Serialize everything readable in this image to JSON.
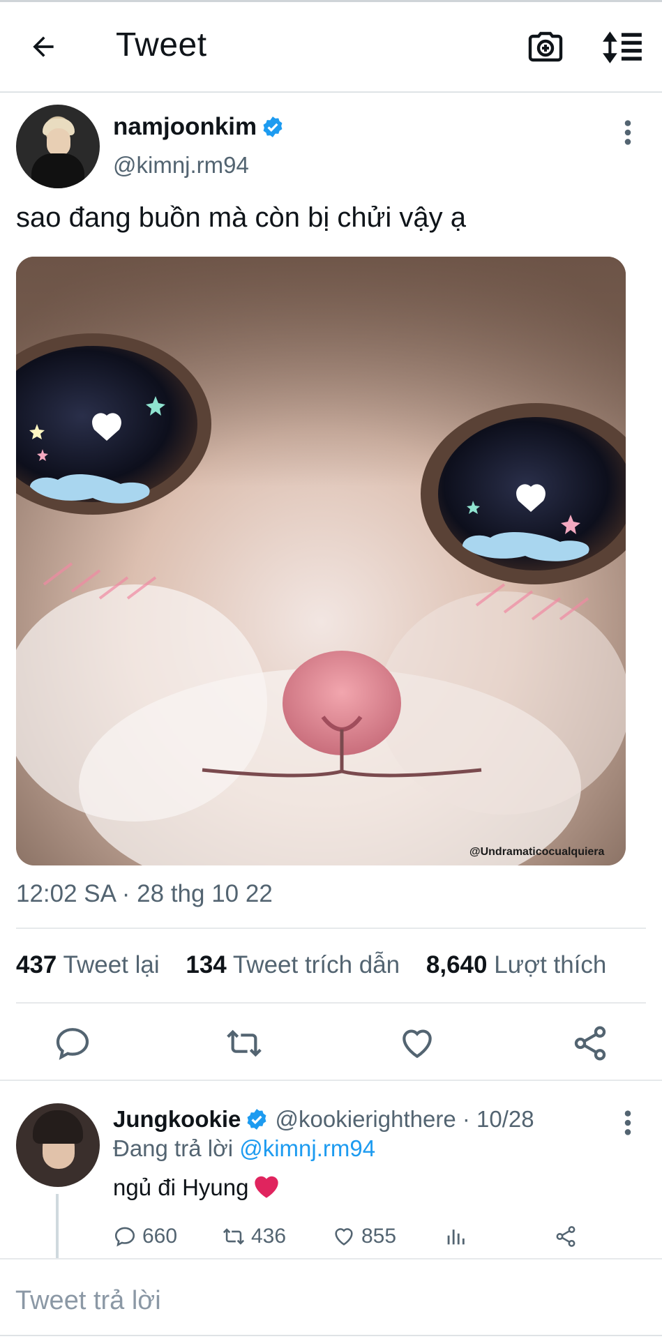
{
  "header": {
    "title": "Tweet",
    "back_icon": "arrow-left-icon",
    "camera_icon": "camera-plus-icon",
    "sort_icon": "sort-list-icon"
  },
  "tweet": {
    "display_name": "namjoonkim",
    "handle": "@kimnj.rm94",
    "text": "sao đang buồn mà còn bị chửi vậy ạ",
    "media_credit": "@Undramaticocualquiera",
    "timestamp": "12:02 SA · 28 thg 10 22",
    "stats": {
      "retweets": "437",
      "retweets_label": "Tweet lại",
      "quotes": "134",
      "quotes_label": "Tweet trích dẫn",
      "likes": "8,640",
      "likes_label": "Lượt thích"
    }
  },
  "reply": {
    "display_name": "Jungkookie",
    "meta": "@kookierighthere · 10/28",
    "replying_prefix": "Đang trả lời ",
    "replying_to": "@kimnj.rm94",
    "text": "ngủ đi Hyung",
    "replies": "660",
    "retweets": "436",
    "likes": "855"
  },
  "composer": {
    "placeholder": "Tweet trả lời"
  },
  "colors": {
    "accent": "#1d9bf0",
    "muted": "#536471",
    "heart": "#e0245e"
  }
}
